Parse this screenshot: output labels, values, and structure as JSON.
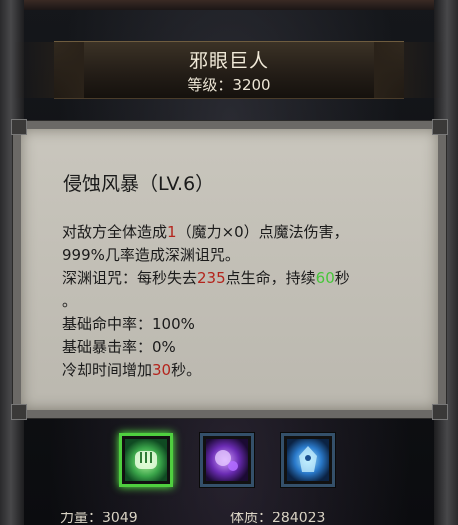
{
  "monster": {
    "name": "邪眼巨人",
    "level_text": "等级：3200"
  },
  "skill": {
    "title": "侵蚀风暴（LV.6）",
    "desc": {
      "line1_a": "对敌方全体造成",
      "line1_value": "1",
      "line1_b": "（魔力×0）点魔法伤害，",
      "line2": "999%几率造成深渊诅咒。",
      "line3_a": "深渊诅咒：每秒失去",
      "line3_value": "235",
      "line3_b": "点生命，持续",
      "line3_duration": "60",
      "line3_c": "秒",
      "line4": "。",
      "line5": "基础命中率：100%",
      "line6": "基础暴击率：0%",
      "line7_a": "冷却时间增加",
      "line7_value": "30",
      "line7_b": "秒。"
    }
  },
  "skill_icons": [
    {
      "icon": "fist-icon",
      "active": true
    },
    {
      "icon": "purple-orb-icon",
      "active": false
    },
    {
      "icon": "blue-spirit-icon",
      "active": false
    }
  ],
  "bottom_stats": {
    "stat1": "力量：3049",
    "stat2": "体质：284023"
  },
  "colors": {
    "highlight_red": "#b4241c",
    "highlight_green": "#47c63a",
    "active_border": "#4fcf3f"
  }
}
